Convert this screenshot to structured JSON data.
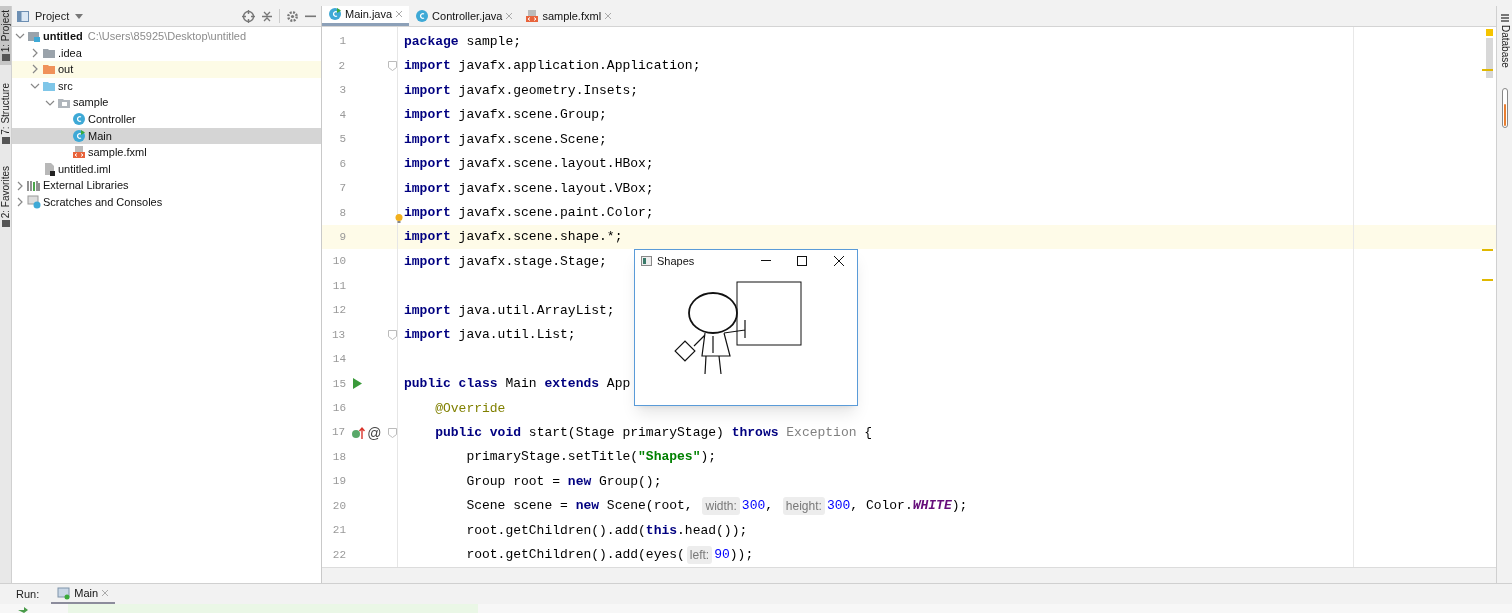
{
  "left_tool_windows": [
    {
      "label": "1: Project",
      "selected": true
    },
    {
      "label": "7: Structure",
      "selected": false
    },
    {
      "label": "2: Favorites",
      "selected": false
    }
  ],
  "project_panel": {
    "title": "Project",
    "tree": [
      {
        "label": "untitled",
        "detail": "C:\\Users\\85925\\Desktop\\untitled",
        "kind": "module",
        "expanded": true,
        "selected": false,
        "highlighted": false,
        "children": [
          {
            "label": ".idea",
            "kind": "folder-gray",
            "expanded": false,
            "selected": false,
            "highlighted": false
          },
          {
            "label": "out",
            "kind": "folder-orange",
            "expanded": false,
            "selected": false,
            "highlighted": true
          },
          {
            "label": "src",
            "kind": "folder-blue",
            "expanded": true,
            "selected": false,
            "highlighted": false,
            "children": [
              {
                "label": "sample",
                "kind": "package",
                "expanded": true,
                "selected": false,
                "highlighted": false,
                "children": [
                  {
                    "label": "Controller",
                    "kind": "class",
                    "selected": false,
                    "highlighted": false
                  },
                  {
                    "label": "Main",
                    "kind": "main-class",
                    "selected": true,
                    "highlighted": false
                  },
                  {
                    "label": "sample.fxml",
                    "kind": "fxml",
                    "selected": false,
                    "highlighted": false
                  }
                ]
              }
            ]
          },
          {
            "label": "untitled.iml",
            "kind": "iml",
            "selected": false,
            "highlighted": false
          }
        ]
      },
      {
        "label": "External Libraries",
        "kind": "libraries",
        "expanded": false,
        "selected": false,
        "highlighted": false
      },
      {
        "label": "Scratches and Consoles",
        "kind": "scratches",
        "expanded": false,
        "selected": false,
        "highlighted": false
      }
    ]
  },
  "editor_tabs": [
    {
      "label": "Main.java",
      "kind": "main-class",
      "selected": true
    },
    {
      "label": "Controller.java",
      "kind": "class",
      "selected": false
    },
    {
      "label": "sample.fxml",
      "kind": "fxml",
      "selected": false
    }
  ],
  "code_lines": [
    {
      "number": "1",
      "current": false,
      "tokens": [
        {
          "kind": "keyword",
          "text": "package"
        },
        {
          "kind": "plain",
          "text": " sample;"
        }
      ]
    },
    {
      "number": "2",
      "current": false,
      "fold": true,
      "tokens": [
        {
          "kind": "keyword",
          "text": "import"
        },
        {
          "kind": "plain",
          "text": " javafx.application.Application;"
        }
      ]
    },
    {
      "number": "3",
      "current": false,
      "tokens": [
        {
          "kind": "keyword",
          "text": "import"
        },
        {
          "kind": "plain",
          "text": " javafx.geometry.Insets;"
        }
      ]
    },
    {
      "number": "4",
      "current": false,
      "tokens": [
        {
          "kind": "keyword",
          "text": "import"
        },
        {
          "kind": "plain",
          "text": " javafx.scene.Group;"
        }
      ]
    },
    {
      "number": "5",
      "current": false,
      "tokens": [
        {
          "kind": "keyword",
          "text": "import"
        },
        {
          "kind": "plain",
          "text": " javafx.scene.Scene;"
        }
      ]
    },
    {
      "number": "6",
      "current": false,
      "tokens": [
        {
          "kind": "keyword",
          "text": "import"
        },
        {
          "kind": "plain",
          "text": " javafx.scene.layout.HBox;"
        }
      ]
    },
    {
      "number": "7",
      "current": false,
      "tokens": [
        {
          "kind": "keyword",
          "text": "import"
        },
        {
          "kind": "plain",
          "text": " javafx.scene.layout.VBox;"
        }
      ]
    },
    {
      "number": "8",
      "current": false,
      "bulb": true,
      "tokens": [
        {
          "kind": "keyword",
          "text": "import"
        },
        {
          "kind": "plain",
          "text": " javafx.scene.paint.Color;"
        }
      ]
    },
    {
      "number": "9",
      "current": true,
      "tokens": [
        {
          "kind": "keyword",
          "text": "import"
        },
        {
          "kind": "plain",
          "text": " javafx.scene.shape.*;"
        }
      ]
    },
    {
      "number": "10",
      "current": false,
      "tokens": [
        {
          "kind": "keyword",
          "text": "import"
        },
        {
          "kind": "plain",
          "text": " javafx.stage.Stage;"
        }
      ]
    },
    {
      "number": "11",
      "current": false
    },
    {
      "number": "12",
      "current": false,
      "tokens": [
        {
          "kind": "keyword",
          "text": "import"
        },
        {
          "kind": "plain",
          "text": " java.util.ArrayList;"
        }
      ]
    },
    {
      "number": "13",
      "current": false,
      "fold": true,
      "tokens": [
        {
          "kind": "keyword",
          "text": "import"
        },
        {
          "kind": "plain",
          "text": " java.util.List;"
        }
      ]
    },
    {
      "number": "14",
      "current": false
    },
    {
      "number": "15",
      "current": false,
      "gutter": [
        {
          "kind": "run"
        }
      ],
      "tokens": [
        {
          "kind": "keyword",
          "text": "public class"
        },
        {
          "kind": "plain",
          "text": " Main "
        },
        {
          "kind": "keyword",
          "text": "extends"
        },
        {
          "kind": "plain",
          "text": " App"
        }
      ]
    },
    {
      "number": "16",
      "current": false,
      "tokens": [
        {
          "kind": "annotation",
          "text": "    @Override"
        }
      ]
    },
    {
      "number": "17",
      "current": false,
      "fold": true,
      "gutter": [
        {
          "kind": "override"
        },
        {
          "kind": "mark",
          "text": "@"
        }
      ],
      "tokens": [
        {
          "kind": "keyword",
          "text": "    public void"
        },
        {
          "kind": "plain",
          "text": " start(Stage primaryStage) "
        },
        {
          "kind": "keyword",
          "text": "throws "
        },
        {
          "kind": "unused",
          "text": "Exception"
        },
        {
          "kind": "plain",
          "text": " {"
        }
      ]
    },
    {
      "number": "18",
      "current": false,
      "tokens": [
        {
          "kind": "plain",
          "text": "        primaryStage.setTitle("
        },
        {
          "kind": "string",
          "text": "\"Shapes\""
        },
        {
          "kind": "plain",
          "text": ");"
        }
      ]
    },
    {
      "number": "19",
      "current": false,
      "tokens": [
        {
          "kind": "plain",
          "text": "        Group root = "
        },
        {
          "kind": "keyword",
          "text": "new"
        },
        {
          "kind": "plain",
          "text": " Group();"
        }
      ]
    },
    {
      "number": "20",
      "current": false,
      "tokens": [
        {
          "kind": "plain",
          "text": "        Scene scene = "
        },
        {
          "kind": "keyword",
          "text": "new"
        },
        {
          "kind": "plain",
          "text": " Scene(root, "
        },
        {
          "kind": "hint",
          "text": "width:"
        },
        {
          "kind": "number",
          "text": "300"
        },
        {
          "kind": "plain",
          "text": ", "
        },
        {
          "kind": "hint",
          "text": "height:"
        },
        {
          "kind": "number",
          "text": "300"
        },
        {
          "kind": "plain",
          "text": ", Color."
        },
        {
          "kind": "constant",
          "text": "WHITE"
        },
        {
          "kind": "plain",
          "text": ");"
        }
      ]
    },
    {
      "number": "21",
      "current": false,
      "tokens": [
        {
          "kind": "plain",
          "text": "        root.getChildren().add("
        },
        {
          "kind": "keyword",
          "text": "this"
        },
        {
          "kind": "plain",
          "text": ".head());"
        }
      ]
    },
    {
      "number": "22",
      "current": false,
      "tokens": [
        {
          "kind": "plain",
          "text": "        root.getChildren().add(eyes("
        },
        {
          "kind": "hint",
          "text": "left:"
        },
        {
          "kind": "number",
          "text": "90"
        },
        {
          "kind": "plain",
          "text": "));"
        }
      ]
    }
  ],
  "app_window": {
    "title": "Shapes"
  },
  "right_tool_windows": [
    {
      "label": "Database"
    }
  ],
  "run_bar": {
    "label": "Run:",
    "tabs": [
      {
        "label": "Main",
        "selected": true
      }
    ]
  }
}
